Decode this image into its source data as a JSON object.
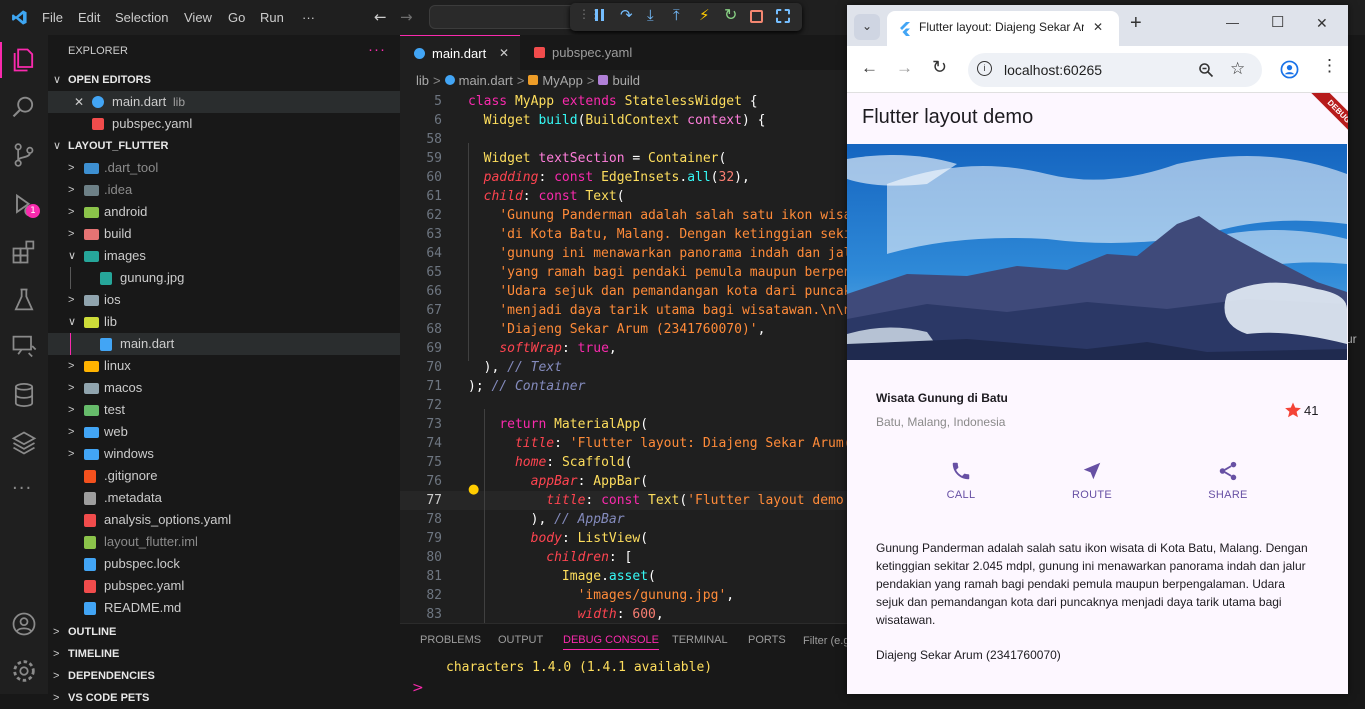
{
  "titlebar": {
    "menus": [
      "File",
      "Edit",
      "Selection",
      "View",
      "Go",
      "Run",
      "···"
    ]
  },
  "activity": {
    "debug_badge": "1"
  },
  "explorer": {
    "title": "EXPLORER",
    "more": "···",
    "open_editors_label": "OPEN EDITORS",
    "open_editors": [
      {
        "name": "main.dart",
        "hint": "lib",
        "close": "✕",
        "icon_color": "#42a5f5"
      },
      {
        "name": "pubspec.yaml",
        "hint": "",
        "icon_color": "#f14c4c"
      }
    ],
    "project_label": "LAYOUT_FLUTTER",
    "tree": [
      {
        "name": ".dart_tool",
        "chev": ">",
        "indent": 1,
        "folder_color": "#3d8fd1",
        "dim": true
      },
      {
        "name": ".idea",
        "chev": ">",
        "indent": 1,
        "folder_color": "#6d8086",
        "dim": true
      },
      {
        "name": "android",
        "chev": ">",
        "indent": 1,
        "folder_color": "#8bc34a",
        "dim": false
      },
      {
        "name": "build",
        "chev": ">",
        "indent": 1,
        "folder_color": "#e57373",
        "dim": false
      },
      {
        "name": "images",
        "chev": "v",
        "indent": 1,
        "folder_color": "#26a69a",
        "dim": false
      },
      {
        "name": "gunung.jpg",
        "chev": "",
        "indent": 2,
        "file_color": "#26a69a",
        "dim": false
      },
      {
        "name": "ios",
        "chev": ">",
        "indent": 1,
        "folder_color": "#90a4ae",
        "dim": false
      },
      {
        "name": "lib",
        "chev": "v",
        "indent": 1,
        "folder_color": "#cddc39",
        "dim": false
      },
      {
        "name": "main.dart",
        "chev": "",
        "indent": 2,
        "file_color": "#42a5f5",
        "dim": false,
        "selected": true
      },
      {
        "name": "linux",
        "chev": ">",
        "indent": 1,
        "folder_color": "#ffb300",
        "dim": false
      },
      {
        "name": "macos",
        "chev": ">",
        "indent": 1,
        "folder_color": "#90a4ae",
        "dim": false
      },
      {
        "name": "test",
        "chev": ">",
        "indent": 1,
        "folder_color": "#66bb6a",
        "dim": false
      },
      {
        "name": "web",
        "chev": ">",
        "indent": 1,
        "folder_color": "#42a5f5",
        "dim": false
      },
      {
        "name": "windows",
        "chev": ">",
        "indent": 1,
        "folder_color": "#42a5f5",
        "dim": false
      },
      {
        "name": ".gitignore",
        "chev": "",
        "indent": 1,
        "file_color": "#f4511e",
        "dim": false
      },
      {
        "name": ".metadata",
        "chev": "",
        "indent": 1,
        "file_color": "#9e9e9e",
        "dim": false
      },
      {
        "name": "analysis_options.yaml",
        "chev": "",
        "indent": 1,
        "file_color": "#f14c4c",
        "dim": false
      },
      {
        "name": "layout_flutter.iml",
        "chev": "",
        "indent": 1,
        "file_color": "#8bc34a",
        "dim": true
      },
      {
        "name": "pubspec.lock",
        "chev": "",
        "indent": 1,
        "file_color": "#42a5f5",
        "dim": false
      },
      {
        "name": "pubspec.yaml",
        "chev": "",
        "indent": 1,
        "file_color": "#f14c4c",
        "dim": false
      },
      {
        "name": "README.md",
        "chev": "",
        "indent": 1,
        "file_color": "#42a5f5",
        "dim": false
      }
    ],
    "bottom_sections": [
      "OUTLINE",
      "TIMELINE",
      "DEPENDENCIES",
      "VS CODE PETS"
    ]
  },
  "editor": {
    "tabs": [
      {
        "name": "main.dart",
        "active": true,
        "close": "✕"
      },
      {
        "name": "pubspec.yaml",
        "active": false
      }
    ],
    "breadcrumb": [
      "lib",
      "main.dart",
      "MyApp",
      "build"
    ],
    "lines": [
      {
        "n": "5",
        "tokens": [
          [
            "kw",
            "class "
          ],
          [
            "ty",
            "MyApp "
          ],
          [
            "kw",
            "extends "
          ],
          [
            "ty",
            "StatelessWidget "
          ],
          [
            "pl",
            "{"
          ]
        ]
      },
      {
        "n": "6",
        "tokens": [
          [
            "pl",
            "  "
          ],
          [
            "ty",
            "Widget "
          ],
          [
            "fn",
            "build"
          ],
          [
            "pl",
            "("
          ],
          [
            "ty",
            "BuildContext "
          ],
          [
            "vr",
            "context"
          ],
          [
            "pl",
            ") {"
          ]
        ]
      },
      {
        "n": "58",
        "tokens": []
      },
      {
        "n": "59",
        "tokens": [
          [
            "pl",
            "  "
          ],
          [
            "ty",
            "Widget "
          ],
          [
            "vr",
            "textSection "
          ],
          [
            "pl",
            "= "
          ],
          [
            "ty",
            "Container"
          ],
          [
            "pl",
            "("
          ]
        ]
      },
      {
        "n": "60",
        "tokens": [
          [
            "pl",
            "  "
          ],
          [
            "pr",
            "padding"
          ],
          [
            "pl",
            ": "
          ],
          [
            "kw",
            "const "
          ],
          [
            "ty",
            "EdgeInsets"
          ],
          [
            "pl",
            "."
          ],
          [
            "fn",
            "all"
          ],
          [
            "pl",
            "("
          ],
          [
            "nm",
            "32"
          ],
          [
            "pl",
            "),"
          ]
        ]
      },
      {
        "n": "61",
        "tokens": [
          [
            "pl",
            "  "
          ],
          [
            "pr",
            "child"
          ],
          [
            "pl",
            ": "
          ],
          [
            "kw",
            "const "
          ],
          [
            "ty",
            "Text"
          ],
          [
            "pl",
            "("
          ]
        ]
      },
      {
        "n": "62",
        "tokens": [
          [
            "pl",
            "    "
          ],
          [
            "st",
            "'Gunung Panderman adalah salah satu ikon wisata "
          ]
        ]
      },
      {
        "n": "63",
        "tokens": [
          [
            "pl",
            "    "
          ],
          [
            "st",
            "'di Kota Batu, Malang. Dengan ketinggian sekit"
          ]
        ]
      },
      {
        "n": "64",
        "tokens": [
          [
            "pl",
            "    "
          ],
          [
            "st",
            "'gunung ini menawarkan panorama indah dan jalu"
          ]
        ]
      },
      {
        "n": "65",
        "tokens": [
          [
            "pl",
            "    "
          ],
          [
            "st",
            "'yang ramah bagi pendaki pemula maupun berpeng"
          ]
        ]
      },
      {
        "n": "66",
        "tokens": [
          [
            "pl",
            "    "
          ],
          [
            "st",
            "'Udara sejuk dan pemandangan kota dari puncakn"
          ]
        ]
      },
      {
        "n": "67",
        "tokens": [
          [
            "pl",
            "    "
          ],
          [
            "st",
            "'menjadi daya tarik utama bagi wisatawan.\\n\\n"
          ]
        ]
      },
      {
        "n": "68",
        "tokens": [
          [
            "pl",
            "    "
          ],
          [
            "st",
            "'Diajeng Sekar Arum (2341760070)'"
          ],
          [
            "pl",
            ","
          ]
        ]
      },
      {
        "n": "69",
        "tokens": [
          [
            "pl",
            "    "
          ],
          [
            "pr",
            "softWrap"
          ],
          [
            "pl",
            ": "
          ],
          [
            "kw",
            "true"
          ],
          [
            "pl",
            ","
          ]
        ]
      },
      {
        "n": "70",
        "tokens": [
          [
            "pl",
            "  ), "
          ],
          [
            "cm",
            "// Text"
          ]
        ]
      },
      {
        "n": "71",
        "tokens": [
          [
            "pl",
            "); "
          ],
          [
            "cm",
            "// Container"
          ]
        ]
      },
      {
        "n": "72",
        "tokens": []
      },
      {
        "n": "73",
        "tokens": [
          [
            "pl",
            "    "
          ],
          [
            "kw",
            "return "
          ],
          [
            "ty",
            "MaterialApp"
          ],
          [
            "pl",
            "("
          ]
        ]
      },
      {
        "n": "74",
        "tokens": [
          [
            "pl",
            "      "
          ],
          [
            "pr",
            "title"
          ],
          [
            "pl",
            ": "
          ],
          [
            "st",
            "'Flutter layout: Diajeng Sekar Arum("
          ]
        ]
      },
      {
        "n": "75",
        "tokens": [
          [
            "pl",
            "      "
          ],
          [
            "pr",
            "home"
          ],
          [
            "pl",
            ": "
          ],
          [
            "ty",
            "Scaffold"
          ],
          [
            "pl",
            "("
          ]
        ]
      },
      {
        "n": "76",
        "tokens": [
          [
            "pl",
            "        "
          ],
          [
            "pr",
            "appBar"
          ],
          [
            "pl",
            ": "
          ],
          [
            "ty",
            "AppBar"
          ],
          [
            "pl",
            "("
          ]
        ]
      },
      {
        "n": "77",
        "tokens": [
          [
            "pl",
            "          "
          ],
          [
            "pr",
            "title"
          ],
          [
            "pl",
            ": "
          ],
          [
            "kw",
            "const "
          ],
          [
            "ty",
            "Text"
          ],
          [
            "pl",
            "("
          ],
          [
            "st",
            "'Flutter layout demo'"
          ]
        ],
        "current": true
      },
      {
        "n": "78",
        "tokens": [
          [
            "pl",
            "        ), "
          ],
          [
            "cm",
            "// AppBar"
          ]
        ]
      },
      {
        "n": "79",
        "tokens": [
          [
            "pl",
            "        "
          ],
          [
            "pr",
            "body"
          ],
          [
            "pl",
            ": "
          ],
          [
            "ty",
            "ListView"
          ],
          [
            "pl",
            "("
          ]
        ]
      },
      {
        "n": "80",
        "tokens": [
          [
            "pl",
            "          "
          ],
          [
            "pr",
            "children"
          ],
          [
            "pl",
            ": ["
          ]
        ]
      },
      {
        "n": "81",
        "tokens": [
          [
            "pl",
            "            "
          ],
          [
            "ty",
            "Image"
          ],
          [
            "pl",
            "."
          ],
          [
            "fn",
            "asset"
          ],
          [
            "pl",
            "("
          ]
        ]
      },
      {
        "n": "82",
        "tokens": [
          [
            "pl",
            "              "
          ],
          [
            "st",
            "'images/gunung.jpg'"
          ],
          [
            "pl",
            ","
          ]
        ]
      },
      {
        "n": "83",
        "tokens": [
          [
            "pl",
            "              "
          ],
          [
            "pr",
            "width"
          ],
          [
            "pl",
            ": "
          ],
          [
            "nm",
            "600"
          ],
          [
            "pl",
            ","
          ]
        ]
      }
    ],
    "panel_tabs": [
      "PROBLEMS",
      "OUTPUT",
      "DEBUG CONSOLE",
      "TERMINAL",
      "PORTS"
    ],
    "panel_active": "DEBUG CONSOLE",
    "panel_filter": "Filter (e.g",
    "console_line": "characters 1.4.0 (1.4.1 available)",
    "console_prompt": ">"
  },
  "browser": {
    "tab_title": "Flutter layout: Diajeng Sekar Arum",
    "new_tab": "+",
    "url": "localhost:60265",
    "win_min": "—",
    "win_max": "☐",
    "win_close": "✕",
    "edge_text": "ur"
  },
  "app": {
    "appbar_title": "Flutter layout demo",
    "debug_banner": "DEBUG",
    "place_title": "Wisata Gunung di Batu",
    "place_location": "Batu, Malang, Indonesia",
    "rating_count": "41",
    "actions": [
      {
        "label": "CALL",
        "icon": "phone-icon"
      },
      {
        "label": "ROUTE",
        "icon": "navigation-icon"
      },
      {
        "label": "SHARE",
        "icon": "share-icon"
      }
    ],
    "description": "Gunung Panderman adalah salah satu ikon wisata di Kota Batu, Malang. Dengan ketinggian sekitar 2.045 mdpl, gunung ini menawarkan panorama indah dan jalur pendakian yang ramah bagi pendaki pemula maupun berpengalaman. Udara sejuk dan pemandangan kota dari puncaknya menjadi daya tarik utama bagi wisatawan.",
    "author": "Diajeng Sekar Arum (2341760070)",
    "accent": "#6750a4",
    "star_color": "#f44336"
  }
}
